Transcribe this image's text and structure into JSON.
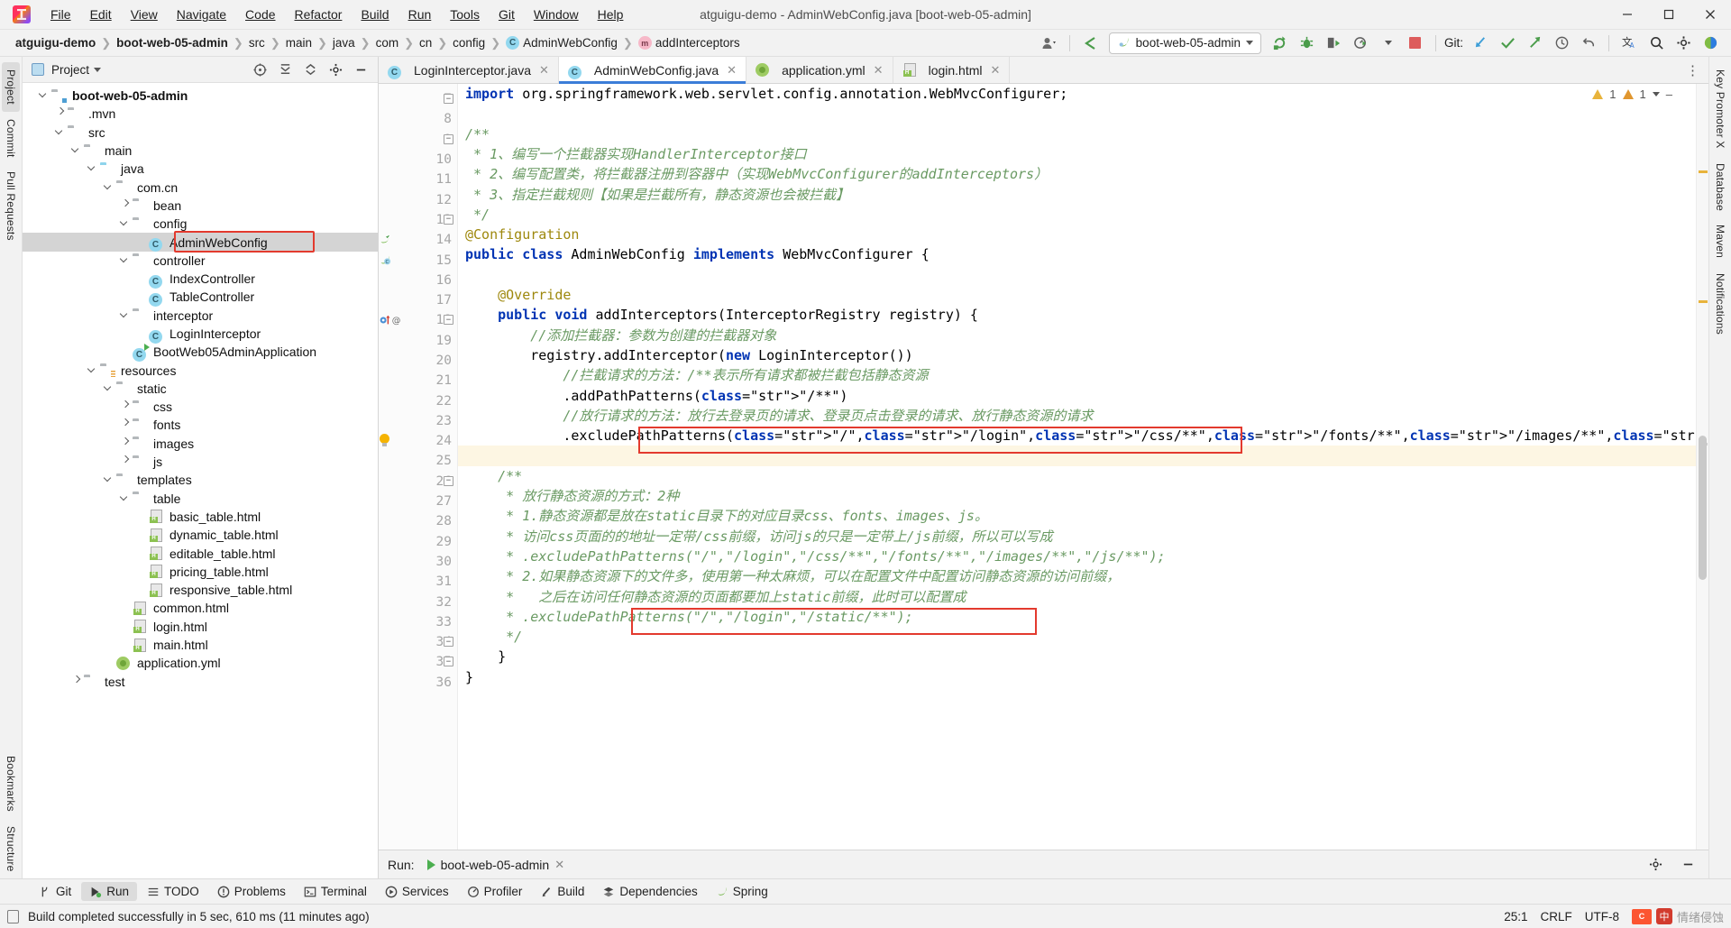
{
  "window": {
    "title": "atguigu-demo - AdminWebConfig.java [boot-web-05-admin]",
    "minimize": "–",
    "maximize": "❐",
    "close": "✕"
  },
  "menubar": [
    "File",
    "Edit",
    "View",
    "Navigate",
    "Code",
    "Refactor",
    "Build",
    "Run",
    "Tools",
    "Git",
    "Window",
    "Help"
  ],
  "breadcrumb": [
    {
      "label": "atguigu-demo",
      "bold": true,
      "icon": ""
    },
    {
      "label": "boot-web-05-admin",
      "bold": true,
      "icon": ""
    },
    {
      "label": "src",
      "bold": false,
      "icon": ""
    },
    {
      "label": "main",
      "bold": false,
      "icon": ""
    },
    {
      "label": "java",
      "bold": false,
      "icon": ""
    },
    {
      "label": "com",
      "bold": false,
      "icon": ""
    },
    {
      "label": "cn",
      "bold": false,
      "icon": ""
    },
    {
      "label": "config",
      "bold": false,
      "icon": ""
    },
    {
      "label": "AdminWebConfig",
      "bold": false,
      "icon": "class-icon"
    },
    {
      "label": "addInterceptors",
      "bold": false,
      "icon": "method-icon"
    }
  ],
  "toolbar": {
    "run_config": "boot-web-05-admin",
    "git_label": "Git:",
    "icons": [
      "user-avatar-icon",
      "back-arrow-icon",
      "rerun-icon",
      "debug-icon",
      "coverage-icon",
      "profile-icon",
      "stop-icon",
      "git-update-icon",
      "git-commit-icon",
      "git-push-icon",
      "history-icon",
      "rollback-icon",
      "translate-icon",
      "search-icon",
      "settings-icon",
      "ide-features-icon"
    ]
  },
  "left_strip": [
    "Project",
    "Commit",
    "Pull Requests",
    "Bookmarks",
    "Structure"
  ],
  "right_strip": [
    "Key Promoter X",
    "Database",
    "Maven",
    "Notifications"
  ],
  "project_panel": {
    "title": "Project",
    "header_icons": [
      "scope-icon",
      "collapse-all-icon",
      "expand-icon",
      "settings-icon",
      "hide-icon"
    ],
    "tree": [
      {
        "depth": 1,
        "label": "boot-web-05-admin",
        "icon": "module-folder-icon",
        "arrow": "down",
        "bold": true,
        "selected": false
      },
      {
        "depth": 2,
        "label": ".mvn",
        "icon": "folder-icon",
        "arrow": "right",
        "bold": false,
        "selected": false
      },
      {
        "depth": 2,
        "label": "src",
        "icon": "folder-icon",
        "arrow": "down",
        "bold": false,
        "selected": false
      },
      {
        "depth": 3,
        "label": "main",
        "icon": "folder-icon",
        "arrow": "down",
        "bold": false,
        "selected": false
      },
      {
        "depth": 4,
        "label": "java",
        "icon": "source-folder-icon",
        "arrow": "down",
        "bold": false,
        "selected": false
      },
      {
        "depth": 5,
        "label": "com.cn",
        "icon": "package-icon",
        "arrow": "down",
        "bold": false,
        "selected": false
      },
      {
        "depth": 6,
        "label": "bean",
        "icon": "package-icon",
        "arrow": "right",
        "bold": false,
        "selected": false
      },
      {
        "depth": 6,
        "label": "config",
        "icon": "package-icon",
        "arrow": "down",
        "bold": false,
        "selected": false
      },
      {
        "depth": 7,
        "label": "AdminWebConfig",
        "icon": "class-icon",
        "arrow": "",
        "bold": false,
        "selected": true
      },
      {
        "depth": 6,
        "label": "controller",
        "icon": "package-icon",
        "arrow": "down",
        "bold": false,
        "selected": false
      },
      {
        "depth": 7,
        "label": "IndexController",
        "icon": "class-icon",
        "arrow": "",
        "bold": false,
        "selected": false
      },
      {
        "depth": 7,
        "label": "TableController",
        "icon": "class-icon",
        "arrow": "",
        "bold": false,
        "selected": false
      },
      {
        "depth": 6,
        "label": "interceptor",
        "icon": "package-icon",
        "arrow": "down",
        "bold": false,
        "selected": false
      },
      {
        "depth": 7,
        "label": "LoginInterceptor",
        "icon": "class-icon",
        "arrow": "",
        "bold": false,
        "selected": false
      },
      {
        "depth": 6,
        "label": "BootWeb05AdminApplication",
        "icon": "runnable-class-icon",
        "arrow": "",
        "bold": false,
        "selected": false
      },
      {
        "depth": 4,
        "label": "resources",
        "icon": "resource-folder-icon",
        "arrow": "down",
        "bold": false,
        "selected": false
      },
      {
        "depth": 5,
        "label": "static",
        "icon": "folder-icon",
        "arrow": "down",
        "bold": false,
        "selected": false
      },
      {
        "depth": 6,
        "label": "css",
        "icon": "folder-icon",
        "arrow": "right",
        "bold": false,
        "selected": false
      },
      {
        "depth": 6,
        "label": "fonts",
        "icon": "folder-icon",
        "arrow": "right",
        "bold": false,
        "selected": false
      },
      {
        "depth": 6,
        "label": "images",
        "icon": "folder-icon",
        "arrow": "right",
        "bold": false,
        "selected": false
      },
      {
        "depth": 6,
        "label": "js",
        "icon": "folder-icon",
        "arrow": "right",
        "bold": false,
        "selected": false
      },
      {
        "depth": 5,
        "label": "templates",
        "icon": "folder-icon",
        "arrow": "down",
        "bold": false,
        "selected": false
      },
      {
        "depth": 6,
        "label": "table",
        "icon": "folder-icon",
        "arrow": "down",
        "bold": false,
        "selected": false
      },
      {
        "depth": 7,
        "label": "basic_table.html",
        "icon": "html-file-icon",
        "arrow": "",
        "bold": false,
        "selected": false
      },
      {
        "depth": 7,
        "label": "dynamic_table.html",
        "icon": "html-file-icon",
        "arrow": "",
        "bold": false,
        "selected": false
      },
      {
        "depth": 7,
        "label": "editable_table.html",
        "icon": "html-file-icon",
        "arrow": "",
        "bold": false,
        "selected": false
      },
      {
        "depth": 7,
        "label": "pricing_table.html",
        "icon": "html-file-icon",
        "arrow": "",
        "bold": false,
        "selected": false
      },
      {
        "depth": 7,
        "label": "responsive_table.html",
        "icon": "html-file-icon",
        "arrow": "",
        "bold": false,
        "selected": false
      },
      {
        "depth": 6,
        "label": "common.html",
        "icon": "html-file-icon",
        "arrow": "",
        "bold": false,
        "selected": false
      },
      {
        "depth": 6,
        "label": "login.html",
        "icon": "html-file-icon",
        "arrow": "",
        "bold": false,
        "selected": false
      },
      {
        "depth": 6,
        "label": "main.html",
        "icon": "html-file-icon",
        "arrow": "",
        "bold": false,
        "selected": false
      },
      {
        "depth": 5,
        "label": "application.yml",
        "icon": "yml-file-icon",
        "arrow": "",
        "bold": false,
        "selected": false
      },
      {
        "depth": 3,
        "label": "test",
        "icon": "folder-icon",
        "arrow": "right",
        "bold": false,
        "selected": false
      }
    ]
  },
  "editor_tabs": [
    {
      "label": "LoginInterceptor.java",
      "icon": "class-icon",
      "active": false
    },
    {
      "label": "AdminWebConfig.java",
      "icon": "class-icon",
      "active": true
    },
    {
      "label": "application.yml",
      "icon": "yml-file-icon",
      "active": false
    },
    {
      "label": "login.html",
      "icon": "html-file-icon",
      "active": false
    }
  ],
  "editor": {
    "warning_count_1": "1",
    "warning_count_2": "1",
    "first_line_number": 7,
    "lines": [
      {
        "n": 7,
        "text": "import org.springframework.web.servlet.config.annotation.WebMvcConfigurer;",
        "type": "import"
      },
      {
        "n": 8,
        "text": "",
        "type": "blank"
      },
      {
        "n": 9,
        "text": "/**",
        "type": "comment"
      },
      {
        "n": 10,
        "text": " * 1、编写一个拦截器实现HandlerInterceptor接口",
        "type": "comment"
      },
      {
        "n": 11,
        "text": " * 2、编写配置类，将拦截器注册到容器中（实现WebMvcConfigurer的addInterceptors）",
        "type": "comment"
      },
      {
        "n": 12,
        "text": " * 3、指定拦截规则【如果是拦截所有，静态资源也会被拦截】",
        "type": "comment"
      },
      {
        "n": 13,
        "text": " */",
        "type": "comment"
      },
      {
        "n": 14,
        "text": "@Configuration",
        "type": "annotation"
      },
      {
        "n": 15,
        "text": "public class AdminWebConfig implements WebMvcConfigurer {",
        "type": "code"
      },
      {
        "n": 16,
        "text": "",
        "type": "blank"
      },
      {
        "n": 17,
        "text": "    @Override",
        "type": "annotation"
      },
      {
        "n": 18,
        "text": "    public void addInterceptors(InterceptorRegistry registry) {",
        "type": "code"
      },
      {
        "n": 19,
        "text": "        //添加拦截器：参数为创建的拦截器对象",
        "type": "comment"
      },
      {
        "n": 20,
        "text": "        registry.addInterceptor(new LoginInterceptor())",
        "type": "code"
      },
      {
        "n": 21,
        "text": "            //拦截请求的方法：/**表示所有请求都被拦截包括静态资源",
        "type": "comment"
      },
      {
        "n": 22,
        "text": "            .addPathPatterns(\"/**\")",
        "type": "code"
      },
      {
        "n": 23,
        "text": "            //放行请求的方法：放行去登录页的请求、登录页点击登录的请求、放行静态资源的请求",
        "type": "comment"
      },
      {
        "n": 24,
        "text": "            .excludePathPatterns(\"/\",\"/login\",\"/css/**\",\"/fonts/**\",\"/images/**\",\"/js/**\");",
        "type": "code-boxed"
      },
      {
        "n": 25,
        "text": "",
        "type": "blank-highlight"
      },
      {
        "n": 26,
        "text": "    /**",
        "type": "comment"
      },
      {
        "n": 27,
        "text": "     * 放行静态资源的方式：2种",
        "type": "comment"
      },
      {
        "n": 28,
        "text": "     * 1.静态资源都是放在static目录下的对应目录css、fonts、images、js。",
        "type": "comment"
      },
      {
        "n": 29,
        "text": "     * 访问css页面的的地址一定带/css前缀，访问js的只是一定带上/js前缀，所以可以写成",
        "type": "comment"
      },
      {
        "n": 30,
        "text": "     * .excludePathPatterns(\"/\",\"/login\",\"/css/**\",\"/fonts/**\",\"/images/**\",\"/js/**\");",
        "type": "comment"
      },
      {
        "n": 31,
        "text": "     * 2.如果静态资源下的文件多，使用第一种太麻烦，可以在配置文件中配置访问静态资源的访问前缀，",
        "type": "comment"
      },
      {
        "n": 32,
        "text": "     *   之后在访问任何静态资源的页面都要加上static前缀，此时可以配置成",
        "type": "comment"
      },
      {
        "n": 33,
        "text": "     * .excludePathPatterns(\"/\",\"/login\",\"/static/**\");",
        "type": "comment-boxed"
      },
      {
        "n": 34,
        "text": "     */",
        "type": "comment"
      },
      {
        "n": 35,
        "text": "    }",
        "type": "code"
      },
      {
        "n": 36,
        "text": "}",
        "type": "code"
      }
    ]
  },
  "run_panel": {
    "label": "Run:",
    "config_name": "boot-web-05-admin",
    "close": "✕"
  },
  "bottom_tabs": [
    {
      "label": "Git",
      "icon": "git-branch-icon",
      "active": false
    },
    {
      "label": "Run",
      "icon": "run-play-icon",
      "active": true
    },
    {
      "label": "TODO",
      "icon": "todo-list-icon",
      "active": false
    },
    {
      "label": "Problems",
      "icon": "problems-icon",
      "active": false
    },
    {
      "label": "Terminal",
      "icon": "terminal-icon",
      "active": false
    },
    {
      "label": "Services",
      "icon": "services-icon",
      "active": false
    },
    {
      "label": "Profiler",
      "icon": "profiler-icon",
      "active": false
    },
    {
      "label": "Build",
      "icon": "build-hammer-icon",
      "active": false
    },
    {
      "label": "Dependencies",
      "icon": "dependencies-icon",
      "active": false
    },
    {
      "label": "Spring",
      "icon": "spring-leaf-icon",
      "active": false
    }
  ],
  "statusbar": {
    "message": "Build completed successfully in 5 sec, 610 ms (11 minutes ago)",
    "caret": "25:1",
    "line_sep": "CRLF",
    "encoding": "UTF-8",
    "ime": "中",
    "watermark": "情绪侵蚀"
  },
  "colors": {
    "accent": "#3b7dd8",
    "red_box": "#e33a2e",
    "selection": "#d4d4d4",
    "keyword": "#0033b3",
    "string": "#067d17",
    "comment": "#6a9a63",
    "annotation": "#9e880d",
    "highlight_line": "#fdf6e3"
  }
}
